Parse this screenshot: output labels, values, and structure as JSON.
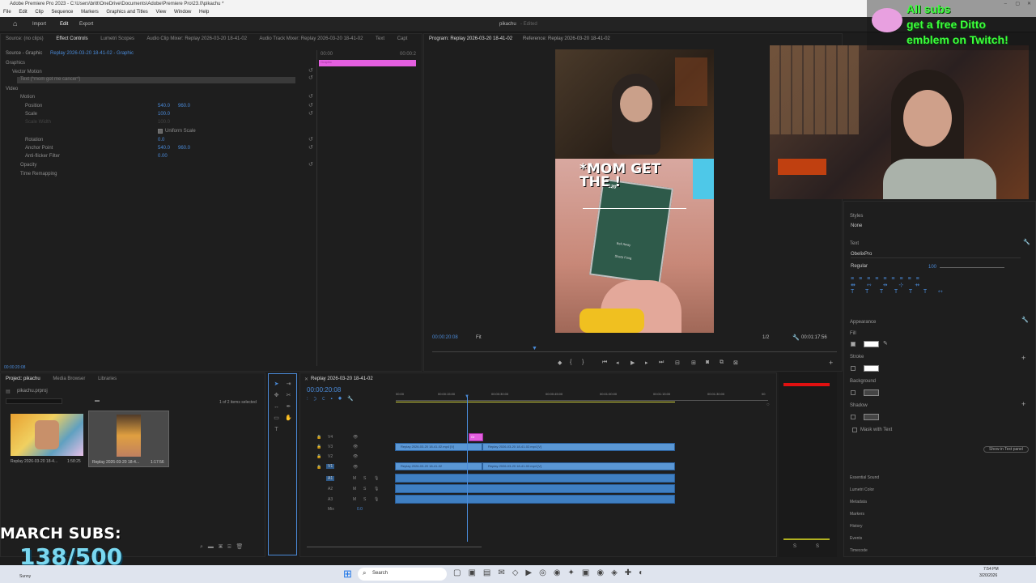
{
  "window": {
    "title": "Adobe Premiere Pro 2023 - C:\\Users\\britt\\OneDrive\\Documents\\Adobe\\Premiere Pro\\23.0\\pikachu *"
  },
  "menu": [
    "File",
    "Edit",
    "Clip",
    "Sequence",
    "Markers",
    "Graphics and Titles",
    "View",
    "Window",
    "Help"
  ],
  "topnav": {
    "import": "Import",
    "edit": "Edit",
    "export": "Export",
    "project_name": "pikachu",
    "status": "- Edited"
  },
  "source_panel": {
    "tabs": [
      "Source: (no clips)",
      "Effect Controls",
      "Lumetri Scopes",
      "Audio Clip Mixer: Replay 2026-03-20 18-41-02",
      "Audio Track Mixer: Replay 2026-03-20 18-41-02",
      "Text",
      "Capt"
    ],
    "master": "Source - Graphic",
    "sequence": "Replay 2026-03-20 18-41-02 - Graphic",
    "mini_timeline_start": "00:00",
    "mini_timeline_end": "00:00:2",
    "clip_label": "Graphic",
    "timecode": "00:00:20:08",
    "sections": {
      "graphics": "Graphics",
      "vector_motion": "Vector Motion",
      "text_layer": "Text (*mom got me cancer*)",
      "video": "Video",
      "motion": "Motion",
      "position": "Position",
      "position_x": "540.0",
      "position_y": "960.0",
      "scale": "Scale",
      "scale_value": "100.0",
      "scale_width": "Scale Width",
      "scale_width_value": "100.0",
      "uniform_scale": "Uniform Scale",
      "rotation": "Rotation",
      "rotation_value": "0.0",
      "anchor_point": "Anchor Point",
      "anchor_x": "540.0",
      "anchor_y": "960.0",
      "anti_flicker": "Anti-flicker Filter",
      "anti_flicker_value": "0.00",
      "opacity": "Opacity",
      "time_remapping": "Time Remapping"
    }
  },
  "program_monitor": {
    "tab_program": "Program: Replay 2026-03-20 18-41-02",
    "tab_reference": "Reference: Replay 2026-03-20 18-41-02",
    "caption_line1": "*MOM GET",
    "caption_line2": "THE !",
    "card_name1": "Eek Away",
    "card_name2": "Sharp Fang",
    "card_hp": "120",
    "timecode": "00:00:20:08",
    "fit": "Fit",
    "quality": "1/2",
    "duration": "00:01:17:56"
  },
  "overlay": {
    "promo_line1": "All subs",
    "promo_line2": "get a free Ditto",
    "promo_line3": "emblem on Twitch!",
    "subs_label": "MARCH SUBS:",
    "subs_count": "138/500"
  },
  "project_panel": {
    "tabs": [
      "Project: pikachu",
      "Media Browser",
      "Libraries"
    ],
    "project_file": "pikachu.prproj",
    "items_selected": "1 of 2 items selected",
    "items": [
      {
        "name": "Replay 2026-03-20 18-4...",
        "duration": "1:58:25"
      },
      {
        "name": "Replay 2026-03-20 18-4...",
        "duration": "1:17:56"
      }
    ]
  },
  "timeline": {
    "tab": "Replay 2026-03-20 18-41-02",
    "timecode": "00:00:20:08",
    "ruler": [
      "00:00",
      "00:00:15:00",
      "00:00:30:00",
      "00:00:45:00",
      "00:01:00:00",
      "00:01:15:00",
      "00:01:30:00",
      "00"
    ],
    "tracks": [
      "V4",
      "V3",
      "V2",
      "V1",
      "A1",
      "A2",
      "A3",
      "Mix"
    ],
    "mix_value": "0.0",
    "clips": {
      "v3_a": "Replay 2026-03-20 18-41-02.mp4 [V]",
      "v3_b": "Replay 2026-03-20 18-41-02.mp4 [V]",
      "v1_a": "Replay 2026-03-20 18-41-02",
      "v1_b": "Replay 2026-03-20 18-41-02.mp4 [V]",
      "graphic": "Gr"
    }
  },
  "essential_graphics": {
    "styles_label": "Styles",
    "styles_value": "None",
    "text_label": "Text",
    "font": "ObelixPro",
    "font_style": "Regular",
    "font_size": "100",
    "appearance_label": "Appearance",
    "fill": "Fill",
    "stroke": "Stroke",
    "background": "Background",
    "shadow": "Shadow",
    "mask_with_text": "Mask with Text",
    "show_in_text_panel": "Show in Text panel",
    "panels": [
      "Essential Sound",
      "Lumetri Color",
      "Metadata",
      "Markers",
      "History",
      "Events",
      "Timecode"
    ]
  },
  "taskbar": {
    "search": "Search",
    "weather": "Sunny",
    "time": "7:54 PM",
    "date": "3/20/2026"
  },
  "colors": {
    "accent_blue": "#4a8ad8",
    "clip_blue": "#5a97d5",
    "graphic_pink": "#e45fe0",
    "promo_green": "#3cff3c",
    "meter_red": "#e01010"
  }
}
